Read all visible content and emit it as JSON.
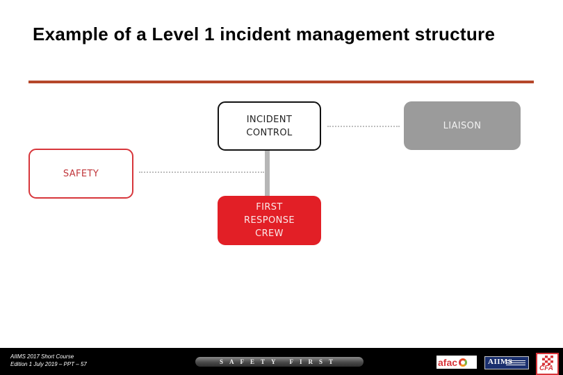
{
  "slide": {
    "title": "Example of a Level 1 incident management structure"
  },
  "diagram": {
    "nodes": {
      "incident_control": "INCIDENT\nCONTROL",
      "liaison": "LIAISON",
      "safety": "SAFETY",
      "first_response_crew": "FIRST\nRESPONSE\nCREW"
    },
    "colors": {
      "title_rule": "#b5472a",
      "liaison_fill": "#9b9b9b",
      "safety_border": "#d7353a",
      "first_response_fill": "#e21f26",
      "connector": "#b6b6b6"
    },
    "links": [
      {
        "from": "incident_control",
        "to": "liaison",
        "style": "dotted"
      },
      {
        "from": "incident_control",
        "to": "safety",
        "style": "dotted"
      },
      {
        "from": "incident_control",
        "to": "first_response_crew",
        "style": "solid"
      }
    ]
  },
  "footer": {
    "line1": "AIIMS 2017 Short Course",
    "line2": "Edition 1 July 2019 – PPT – 57",
    "banner": "SAFETY FIRST",
    "logos": {
      "afac": "afac",
      "aiims": "AIIMS",
      "cfa": "CFA"
    }
  }
}
